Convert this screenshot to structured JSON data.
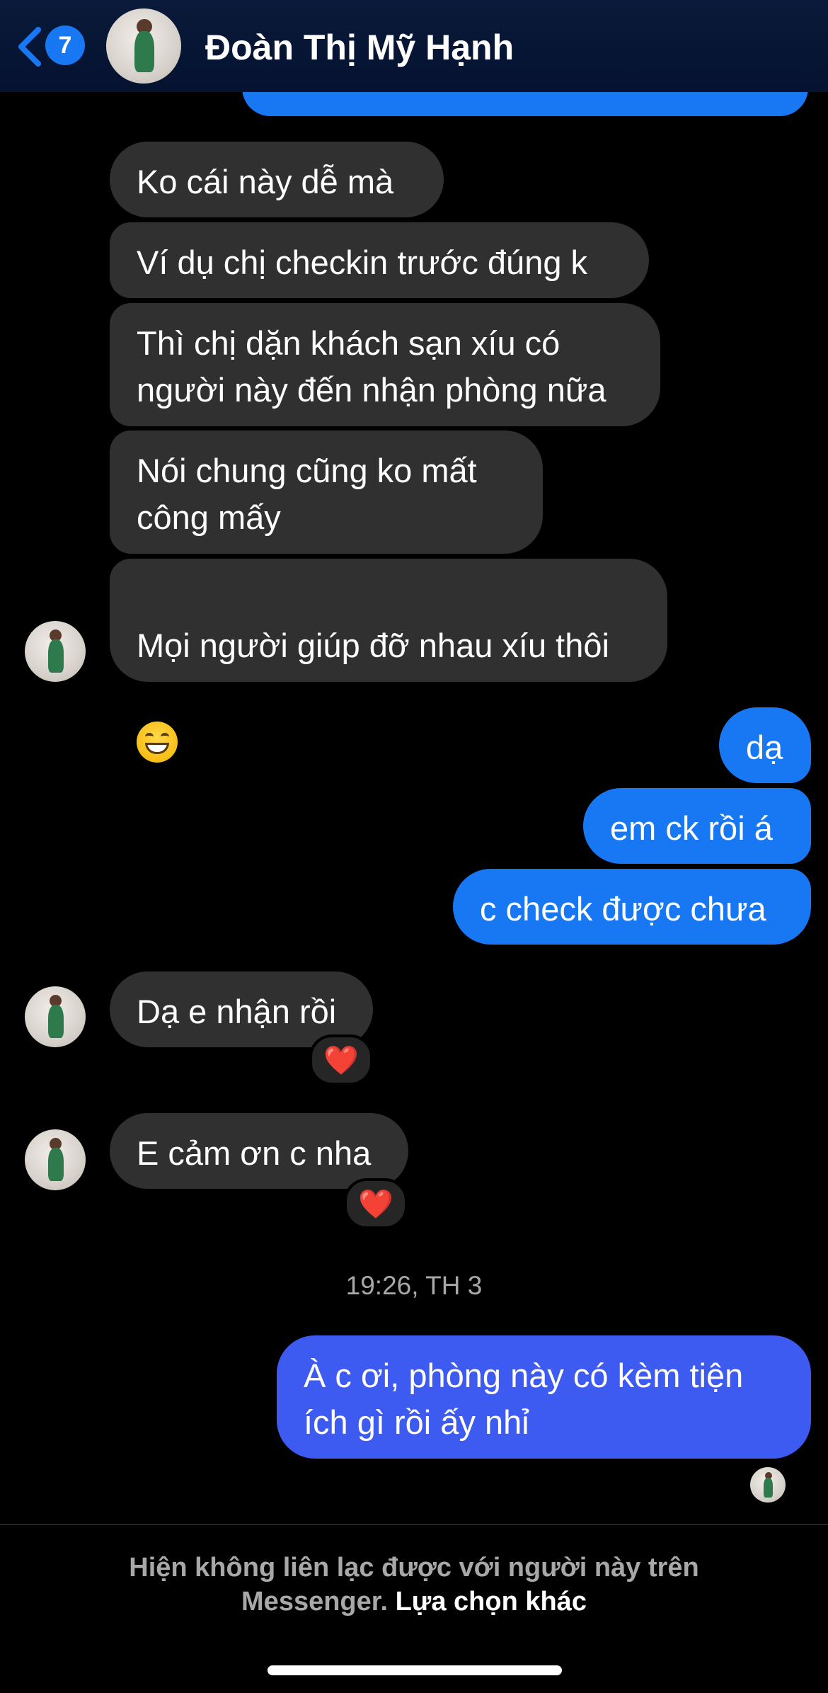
{
  "header": {
    "back_label": "back",
    "unread_count": "7",
    "contact_name": "Đoàn Thị Mỹ Hạnh"
  },
  "messages": [
    {
      "text": "Ko cái này dễ mà"
    },
    {
      "text": "Ví dụ chị checkin trước đúng k"
    },
    {
      "text": "Thì chị dặn khách sạn xíu có\nngười này đến nhận phòng nữa"
    },
    {
      "text": "Nói chung cũng ko mất\ncông mấy"
    },
    {
      "text": "Mọi người giúp đỡ nhau xíu thôi"
    },
    {
      "text": "dạ"
    },
    {
      "text": "em ck rồi á"
    },
    {
      "text": "c check được chưa"
    },
    {
      "text": "Dạ e nhận rồi"
    },
    {
      "text": "E cảm ơn c nha"
    },
    {
      "text": "À c ơi, phòng này có kèm tiện\ních gì rồi ấy nhỉ"
    }
  ],
  "reactions": {
    "heart": "❤️"
  },
  "timestamp": "19:26, TH 3",
  "footer": {
    "notice": "Hiện không liên lạc được với người này trên\nMessenger.",
    "link": "Lựa chọn khác"
  },
  "icons": {
    "back": "chevron-left-icon",
    "emoji_grin": "grinning-face-icon",
    "heart": "heart-icon"
  },
  "colors": {
    "outgoing_bubble": "#1877f2",
    "incoming_bubble": "#303030",
    "background": "#000000"
  }
}
